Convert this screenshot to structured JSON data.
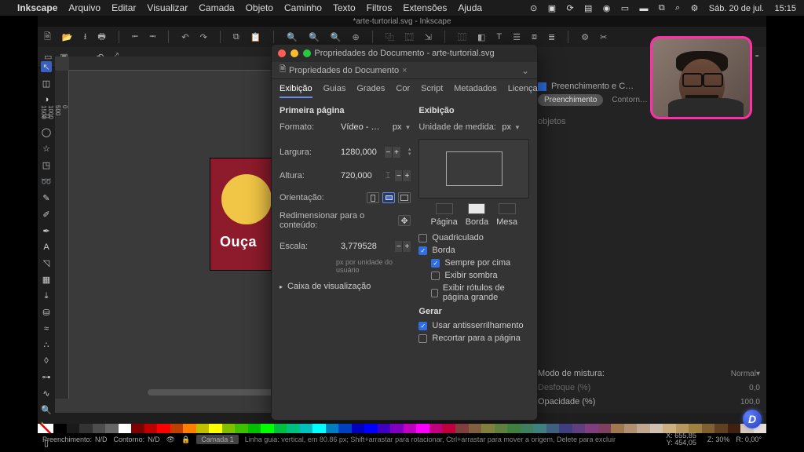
{
  "menubar": {
    "app": "Inkscape",
    "items": [
      "Arquivo",
      "Editar",
      "Visualizar",
      "Camada",
      "Objeto",
      "Caminho",
      "Texto",
      "Filtros",
      "Extensões",
      "Ajuda"
    ],
    "date": "Sáb. 20 de jul.",
    "time": "15:15"
  },
  "window_title": "*arte-turtorial.svg - Inkscape",
  "dialog": {
    "title": "Propriedades do Documento - arte-turtorial.svg",
    "tab_label": "Propriedades do Documento",
    "subtabs": [
      "Exibição",
      "Guias",
      "Grades",
      "Cor",
      "Script",
      "Metadados",
      "Licença"
    ],
    "left": {
      "section": "Primeira página",
      "format_label": "Formato:",
      "format_value": "Vídeo - …",
      "format_unit": "px",
      "width_label": "Largura:",
      "width_value": "1280,000",
      "height_label": "Altura:",
      "height_value": "720,000",
      "orient_label": "Orientação:",
      "resize_label": "Redimensionar para o conteúdo:",
      "scale_label": "Escala:",
      "scale_value": "3,779528",
      "scale_hint": "px por unidade do usuário",
      "viewbox_label": "Caixa de visualização"
    },
    "right": {
      "section": "Exibição",
      "unit_label": "Unidade de medida:",
      "unit_value": "px",
      "swatches": {
        "page": "Página",
        "border": "Borda",
        "desk": "Mesa"
      },
      "opts": {
        "grid": "Quadriculado",
        "border": "Borda",
        "ontop": "Sempre por cima",
        "shadow": "Exibir sombra",
        "biglabels": "Exibir rótulos de página grande"
      },
      "render_section": "Gerar",
      "render": {
        "aa": "Usar antisserrilhamento",
        "clip": "Recortar para a página"
      }
    }
  },
  "rightpanel": {
    "fillstroke_tab": "Preenchimento e C…",
    "fill": "Preenchimento",
    "stroke": "Contorn…",
    "objects_hint": "objetos",
    "blend_label": "Modo de mistura:",
    "blend_value": "Normal",
    "blur_label": "Desfoque (%)",
    "blur_value": "0,0",
    "opacity_label": "Opacidade (%)",
    "opacity_value": "100,0"
  },
  "canvas_text": "Ouça",
  "unit_selector": "px",
  "ruler_v_ticks": [
    "0",
    "500",
    "1000",
    "1500"
  ],
  "status": {
    "fill_label": "Preenchimento:",
    "fill_value": "N/D",
    "stroke_label": "Contorno:",
    "stroke_value": "N/D",
    "layer_label": "Camada 1",
    "hint": "Linha guia: vertical, em 80.86 px; Shift+arrastar para rotacionar, Ctrl+arrastar para mover a origem, Delete para excluir",
    "x": "655,85",
    "y": "454,05",
    "z_label": "Z:",
    "z": "30%",
    "r_label": "R:",
    "r": "0,00°"
  },
  "palette": [
    "#000000",
    "#1a1a1a",
    "#333333",
    "#4d4d4d",
    "#666666",
    "#ffffff",
    "#7f0000",
    "#bf0000",
    "#ff0000",
    "#bf3f00",
    "#ff7f00",
    "#bfbf00",
    "#ffff00",
    "#7fbf00",
    "#3fbf00",
    "#00bf00",
    "#00ff00",
    "#00bf3f",
    "#00bf7f",
    "#00bfbf",
    "#00ffff",
    "#007fbf",
    "#003fbf",
    "#0000bf",
    "#0000ff",
    "#3f00bf",
    "#7f00bf",
    "#bf00bf",
    "#ff00ff",
    "#bf007f",
    "#bf003f",
    "#7f3f3f",
    "#7f5f3f",
    "#7f7f3f",
    "#5f7f3f",
    "#3f7f3f",
    "#3f7f5f",
    "#3f7f7f",
    "#3f5f7f",
    "#3f3f7f",
    "#5f3f7f",
    "#7f3f7f",
    "#7f3f5f",
    "#a07850",
    "#b09070",
    "#c0a890",
    "#d0c0b0",
    "#ccb080",
    "#b89860",
    "#a08040",
    "#806030",
    "#604020",
    "#402010",
    "#d8c8b8",
    "#e8e0d8"
  ],
  "chart_data": null
}
